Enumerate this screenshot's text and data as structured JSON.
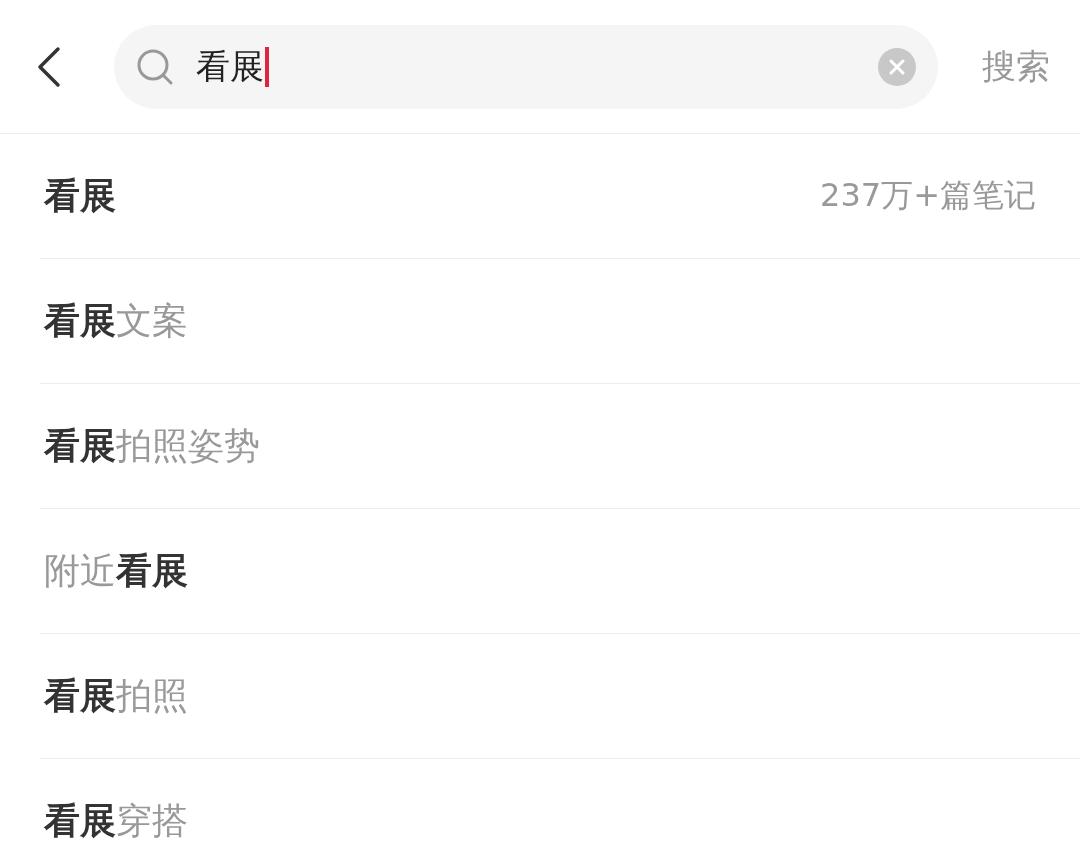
{
  "header": {
    "search": {
      "value": "看展",
      "focused": true
    },
    "search_button": "搜索"
  },
  "suggestions": [
    {
      "text": "**看展**",
      "count": "237万+篇笔记"
    },
    {
      "text": "**看展**文案"
    },
    {
      "text": "**看展**拍照姿势"
    },
    {
      "text": "附近**看展**"
    },
    {
      "text": "**看展**拍照"
    },
    {
      "text": "**看展**穿搭"
    }
  ]
}
